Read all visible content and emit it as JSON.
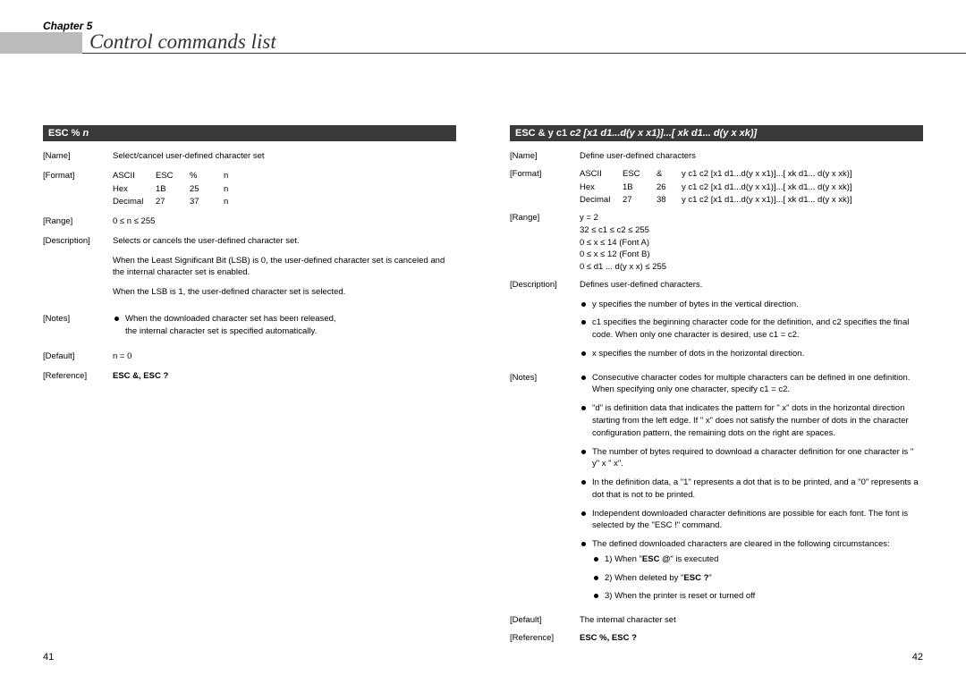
{
  "chapter": "Chapter 5",
  "page_title": "Control commands list",
  "page_left": "41",
  "page_right": "42",
  "left": {
    "header_fixed": "ESC % ",
    "header_param": "n",
    "name": "Select/cancel user-defined character set",
    "fmt": {
      "r1c1": "ASCII",
      "r1c2": "ESC",
      "r1c3": "%",
      "r1c4": "n",
      "r2c1": "Hex",
      "r2c2": "1B",
      "r2c3": "25",
      "r2c4": "n",
      "r3c1": "Decimal",
      "r3c2": "27",
      "r3c3": "37",
      "r3c4": "n"
    },
    "range": "0 ≤ n ≤ 255",
    "desc_p1": "Selects or cancels the user-defined character set.",
    "desc_p2": "When the Least Significant Bit (LSB) is 0, the user-defined character set is canceled and the internal character set is enabled.",
    "desc_p3": "When the LSB is 1, the user-defined character set is selected.",
    "note1a": "When the downloaded character set has been released,",
    "note1b": "the internal character set is specified automatically.",
    "default": "n = 0",
    "reference": "ESC &, ESC ?",
    "lbl_name": "[Name]",
    "lbl_format": "[Format]",
    "lbl_range": "[Range]",
    "lbl_desc": "[Description]",
    "lbl_notes": "[Notes]",
    "lbl_default": "[Default]",
    "lbl_ref": "[Reference]"
  },
  "right": {
    "header_fixed": "ESC & y c1 ",
    "header_param": "c2 [x1 d1...d(y x x1)]...[ xk d1... d(y x xk)]",
    "name": "Define user-defined characters",
    "fmt": {
      "r1c1": "ASCII",
      "r1c2": "ESC",
      "r1c3": "&",
      "r1c4": "y c1 c2 [x1 d1...d(y x x1)]...[ xk d1... d(y x xk)]",
      "r2c1": "Hex",
      "r2c2": "1B",
      "r2c3": "26",
      "r2c4": "y c1 c2 [x1 d1...d(y x x1)]...[ xk d1... d(y x xk)]",
      "r3c1": "Decimal",
      "r3c2": "27",
      "r3c3": "38",
      "r3c4": "y c1 c2 [x1 d1...d(y x x1)]...[ xk d1... d(y x xk)]"
    },
    "range1": "y = 2",
    "range2": "32 ≤ c1 ≤ c2 ≤ 255",
    "range3": "0 ≤ x ≤ 14 (Font A)",
    "range4": "0 ≤ x ≤ 12 (Font B)",
    "range5": "0 ≤ d1 ... d(y x x) ≤ 255",
    "desc_p1": "Defines user-defined characters.",
    "b1": "y specifies the number of bytes in the vertical direction.",
    "b2": "c1 specifies the beginning character code for the definition, and c2 specifies the final code. When only one character is desired, use c1 = c2.",
    "b3": "x specifies the number of dots in the horizontal direction.",
    "n1": "Consecutive character codes for multiple characters can be defined in one definition. When specifying only one character, specify c1 = c2.",
    "n2": "\"d\" is definition data that indicates the pattern for \" x\" dots in the horizontal direction starting from the left edge. If \" x\" does not satisfy the number of dots in the character configuration pattern, the remaining dots on the right are spaces.",
    "n3": "The number of bytes required to download a character definition for one character is \" y\"  x \" x\".",
    "n4": "In the definition data, a \"1\" represents a dot that is to be printed, and a \"0\" represents a dot that is not to be printed.",
    "n5": "Independent downloaded character definitions are possible for each font. The font is selected by the \"ESC !\" command.",
    "n6": "The defined downloaded characters are cleared in the following circumstances:",
    "n6_s1_a": "1) When \"",
    "n6_s1_b": "ESC @",
    "n6_s1_c": "\" is executed",
    "n6_s2_a": "2) When deleted by \"",
    "n6_s2_b": "ESC ?",
    "n6_s2_c": "\"",
    "n6_s3": "3) When the printer is reset or turned off",
    "default": "The internal character set",
    "reference": "ESC %, ESC ?",
    "lbl_name": "[Name]",
    "lbl_format": "[Format]",
    "lbl_range": "[Range]",
    "lbl_desc": "[Description]",
    "lbl_notes": "[Notes]",
    "lbl_default": "[Default]",
    "lbl_ref": "[Reference]"
  }
}
